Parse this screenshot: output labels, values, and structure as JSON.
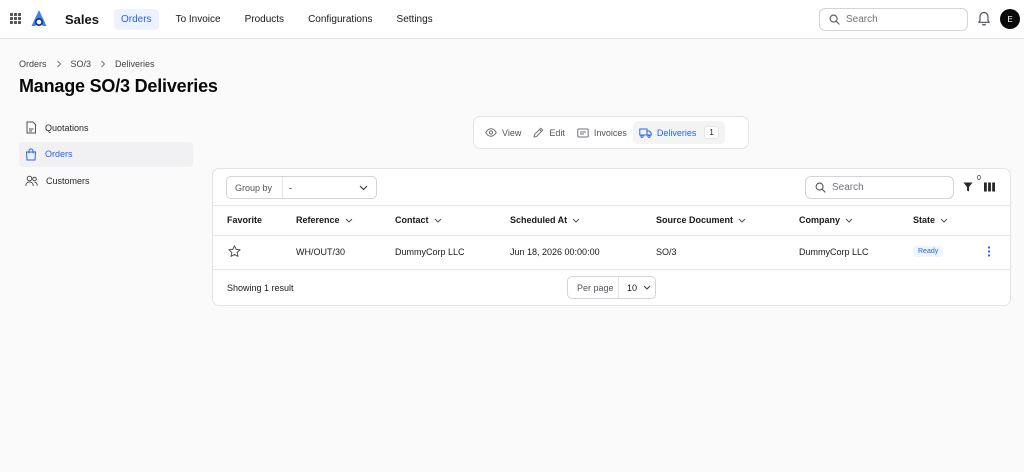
{
  "header": {
    "app_name": "Sales",
    "nav": [
      {
        "label": "Orders",
        "active": true
      },
      {
        "label": "To Invoice",
        "active": false
      },
      {
        "label": "Products",
        "active": false
      },
      {
        "label": "Configurations",
        "active": false
      },
      {
        "label": "Settings",
        "active": false
      }
    ],
    "search_placeholder": "Search",
    "avatar_initial": "E"
  },
  "breadcrumb": [
    "Orders",
    "SO/3",
    "Deliveries"
  ],
  "page_title": "Manage SO/3 Deliveries",
  "sidebar": {
    "items": [
      {
        "label": "Quotations",
        "icon": "document-icon",
        "active": false
      },
      {
        "label": "Orders",
        "icon": "shopping-bag-icon",
        "active": true
      },
      {
        "label": "Customers",
        "icon": "users-icon",
        "active": false
      }
    ]
  },
  "tabs": [
    {
      "label": "View",
      "icon": "eye-icon",
      "active": false
    },
    {
      "label": "Edit",
      "icon": "pencil-icon",
      "active": false
    },
    {
      "label": "Invoices",
      "icon": "receipt-icon",
      "active": false
    },
    {
      "label": "Deliveries",
      "icon": "truck-icon",
      "active": true,
      "count": "1"
    }
  ],
  "toolbar": {
    "group_by_label": "Group by",
    "group_by_value": "-",
    "search_placeholder": "Search",
    "filter_count": "0"
  },
  "table": {
    "columns": [
      "Favorite",
      "Reference",
      "Contact",
      "Scheduled At",
      "Source Document",
      "Company",
      "State"
    ],
    "rows": [
      {
        "favorite": false,
        "reference": "WH/OUT/30",
        "contact": "DummyCorp LLC",
        "scheduled_at": "Jun 18, 2026 00:00:00",
        "source_document": "SO/3",
        "company": "DummyCorp LLC",
        "state": "Ready"
      }
    ]
  },
  "footer": {
    "result_text": "Showing 1 result",
    "per_page_label": "Per page",
    "per_page_value": "10"
  },
  "colors": {
    "accent": "#2563eb",
    "accent_bg": "#eef2ff",
    "border": "#e4e4e7",
    "background": "#fafafa"
  }
}
